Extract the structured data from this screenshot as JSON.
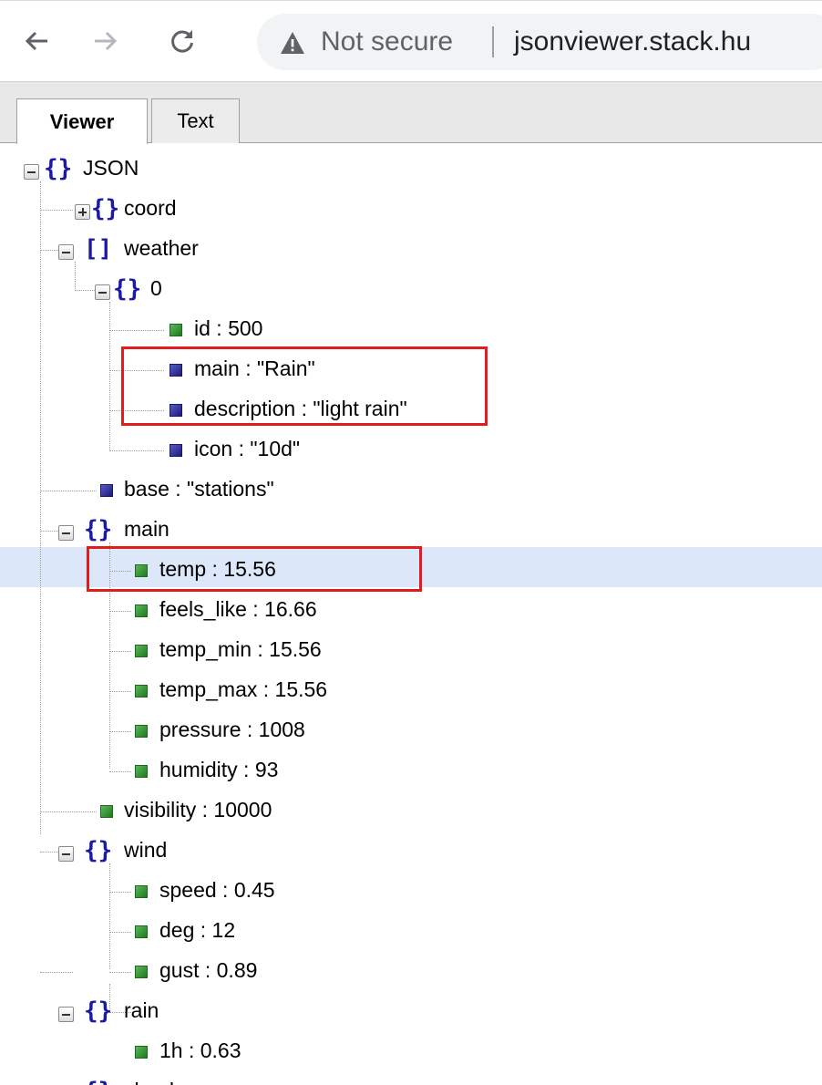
{
  "browser": {
    "back_icon": "arrow-left-icon",
    "forward_icon": "arrow-right-icon",
    "reload_icon": "reload-icon",
    "security_icon": "warning-triangle-icon",
    "security_status": "Not secure",
    "url": "jsonviewer.stack.hu"
  },
  "tabs": [
    {
      "label": "Viewer",
      "active": true
    },
    {
      "label": "Text",
      "active": false
    }
  ],
  "tree": {
    "root": "JSON",
    "coord": "coord",
    "weather": "weather",
    "weather_0": "0",
    "weather_0_id": "id : 500",
    "weather_0_main": "main : \"Rain\"",
    "weather_0_description": "description : \"light rain\"",
    "weather_0_icon": "icon : \"10d\"",
    "base": "base : \"stations\"",
    "main": "main",
    "main_temp": "temp : 15.56",
    "main_feels_like": "feels_like : 16.66",
    "main_temp_min": "temp_min : 15.56",
    "main_temp_max": "temp_max : 15.56",
    "main_pressure": "pressure : 1008",
    "main_humidity": "humidity : 93",
    "visibility": "visibility : 10000",
    "wind": "wind",
    "wind_speed": "speed : 0.45",
    "wind_deg": "deg : 12",
    "wind_gust": "gust : 0.89",
    "rain": "rain",
    "rain_1h": "1h : 0.63",
    "clouds": "clouds"
  },
  "colors": {
    "highlight": "#e31b1b",
    "selection": "#dce8fa",
    "number_leaf": "#2e8b2e",
    "string_leaf": "#23238c",
    "brace": "#1a1aa6"
  }
}
